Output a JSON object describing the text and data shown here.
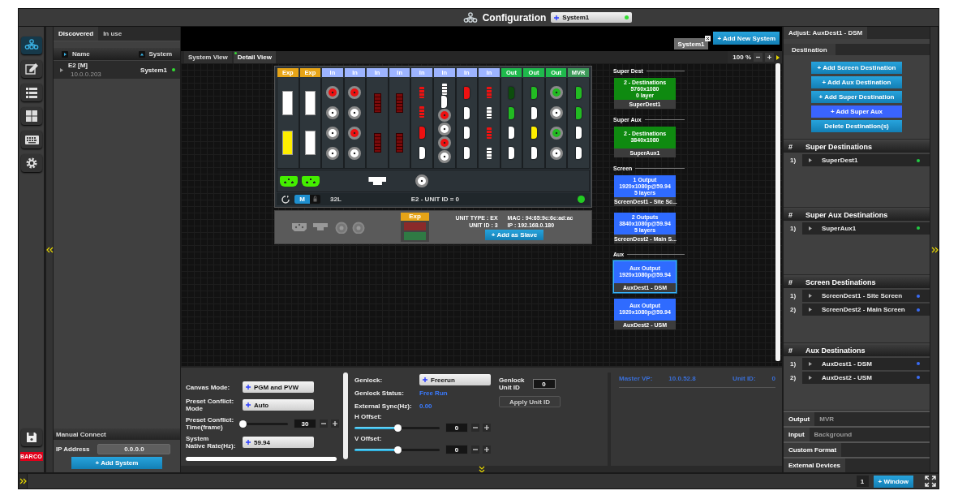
{
  "header": {
    "title": "Configuration",
    "system": "System1",
    "system_online": true
  },
  "rail": {
    "items": [
      {
        "kind": "network",
        "selected": true
      },
      {
        "kind": "edit",
        "selected": false
      },
      {
        "kind": "list",
        "selected": false
      },
      {
        "kind": "grid",
        "selected": false
      },
      {
        "kind": "keyboard",
        "selected": false
      },
      {
        "kind": "settings",
        "selected": false
      }
    ],
    "logo": "BARCO"
  },
  "discovery": {
    "tabs": [
      {
        "label": "Discovered",
        "selected": true
      },
      {
        "label": "In use",
        "selected": false
      }
    ],
    "columns": [
      "Name",
      "System"
    ],
    "rows": [
      {
        "name": "E2  [M]",
        "address": "10.0.0.203",
        "system": "System1",
        "online": true
      }
    ],
    "manual_connect": {
      "title": "Manual Connect",
      "ip_label": "IP Address",
      "ip_value": "0.0.0.0",
      "button": "+ Add System"
    }
  },
  "systems": {
    "tabs": [
      {
        "label": "System1",
        "selected": true
      }
    ],
    "add_button": "+ Add New System"
  },
  "view_tabs": [
    {
      "label": "System View",
      "selected": false
    },
    {
      "label": "Detail View",
      "selected": true
    }
  ],
  "zoom": "100 %",
  "chassis": {
    "slots": [
      {
        "label": "Exp",
        "kind": "exp",
        "ports": [
          {
            "kind": "rect",
            "color": "#ffffff"
          },
          {
            "kind": "rect",
            "color": "#ffee00"
          }
        ],
        "rear": {
          "kind": "power",
          "color": "#44ee00"
        }
      },
      {
        "label": "Exp",
        "kind": "exp",
        "ports": [
          {
            "kind": "rect",
            "color": "#ffffff"
          },
          {
            "kind": "rect",
            "color": "#ffffff"
          }
        ],
        "rear": {
          "kind": "power",
          "color": "#44ee00"
        }
      },
      {
        "label": "In",
        "kind": "in",
        "ports": [
          {
            "kind": "bnc",
            "color": "#ee1111"
          },
          {
            "kind": "bnc",
            "color": "#ffffff"
          },
          {
            "kind": "bnc",
            "color": "#ffffff"
          },
          {
            "kind": "bnc",
            "color": "#ffffff"
          }
        ]
      },
      {
        "label": "In",
        "kind": "in",
        "ports": [
          {
            "kind": "bnc",
            "color": "#ee1111"
          },
          {
            "kind": "bnc",
            "color": "#ffffff"
          },
          {
            "kind": "bnc",
            "color": "#ee1111"
          },
          {
            "kind": "bnc",
            "color": "#ffffff"
          }
        ]
      },
      {
        "label": "In",
        "kind": "in",
        "ports": [
          {
            "kind": "dvi",
            "color": "#7a0a0a"
          },
          {
            "kind": "dvi",
            "color": "#7a0a0a"
          }
        ],
        "rear": {
          "kind": "ethernet",
          "color": "#ffffff"
        }
      },
      {
        "label": "In",
        "kind": "in",
        "ports": [
          {
            "kind": "dvi",
            "color": "#7a0a0a"
          },
          {
            "kind": "dvi",
            "color": "#7a0a0a"
          }
        ]
      },
      {
        "label": "In",
        "kind": "in",
        "ports": [
          {
            "kind": "dp",
            "color": "#ee1111"
          },
          {
            "kind": "dp",
            "color": "#ee1111"
          },
          {
            "kind": "hdmi",
            "color": "#ee1111"
          },
          {
            "kind": "hdmi",
            "color": "#ffffff"
          }
        ],
        "rear": {
          "kind": "bnc",
          "color": "#ffffff"
        }
      },
      {
        "label": "In",
        "kind": "in",
        "ports": [
          {
            "kind": "dp",
            "color": "#ffffff"
          },
          {
            "kind": "hdmi",
            "color": "#ffffff"
          },
          {
            "kind": "bnc",
            "color": "#ee1111"
          },
          {
            "kind": "bnc",
            "color": "#ffffff"
          },
          {
            "kind": "bnc",
            "color": "#ee1111"
          },
          {
            "kind": "bnc",
            "color": "#ffffff"
          }
        ]
      },
      {
        "label": "In",
        "kind": "in",
        "ports": [
          {
            "kind": "hdmi",
            "color": "#ee1111"
          },
          {
            "kind": "hdmi",
            "color": "#ffffff"
          },
          {
            "kind": "hdmi",
            "color": "#ffffff"
          },
          {
            "kind": "hdmi",
            "color": "#ffffff"
          }
        ]
      },
      {
        "label": "In",
        "kind": "in",
        "ports": [
          {
            "kind": "dp",
            "color": "#ee1111"
          },
          {
            "kind": "dp",
            "color": "#ffffff"
          },
          {
            "kind": "dp",
            "color": "#ee1111"
          },
          {
            "kind": "dp",
            "color": "#ffffff"
          }
        ]
      },
      {
        "label": "Out",
        "kind": "out",
        "ports": [
          {
            "kind": "hdmi",
            "color": "#0d4d0d"
          },
          {
            "kind": "hdmi",
            "color": "#22bb22"
          },
          {
            "kind": "hdmi",
            "color": "#ffffff"
          },
          {
            "kind": "hdmi",
            "color": "#ffffff"
          }
        ]
      },
      {
        "label": "Out",
        "kind": "out",
        "ports": [
          {
            "kind": "hdmi",
            "color": "#22bb22"
          },
          {
            "kind": "hdmi",
            "color": "#ffffff"
          },
          {
            "kind": "hdmi",
            "color": "#ffee00"
          },
          {
            "kind": "hdmi",
            "color": "#ffffff"
          }
        ]
      },
      {
        "label": "Out",
        "kind": "out",
        "ports": [
          {
            "kind": "bnc",
            "color": "#22bb22"
          },
          {
            "kind": "bnc",
            "color": "#ffffff"
          },
          {
            "kind": "bnc",
            "color": "#22bb22"
          },
          {
            "kind": "bnc",
            "color": "#ffffff"
          }
        ]
      },
      {
        "label": "MVR",
        "kind": "mvr",
        "ports": [
          {
            "kind": "hdmi",
            "color": "#22bb22"
          },
          {
            "kind": "hdmi",
            "color": "#22bb22"
          },
          {
            "kind": "hdmi",
            "color": "#ffffff"
          },
          {
            "kind": "hdmi",
            "color": "#ffffff"
          }
        ]
      }
    ],
    "mode": "M",
    "mode_on": true,
    "format": "32L",
    "unit": "E2 - UNIT ID = 0",
    "online": true,
    "expansion": {
      "label": "Exp",
      "unit_type": "UNIT TYPE : EX",
      "mac": "MAC : 94:65:9c:6c:ad:ac",
      "unit_id": "UNIT ID : 3",
      "ip": "IP : 192.168.0.180",
      "button": "+ Add as Slave"
    }
  },
  "destinations": [
    {
      "title": "Super Dest",
      "cards": [
        {
          "kind": "super",
          "lines": [
            "2 - Destinations",
            "5760x1080",
            "0 layer"
          ],
          "name": "SuperDest1",
          "selected": false
        }
      ]
    },
    {
      "title": "Super Aux",
      "cards": [
        {
          "kind": "super",
          "lines": [
            "2 - Destinations",
            "3840x1080"
          ],
          "name": "SuperAux1",
          "selected": false
        }
      ]
    },
    {
      "title": "Screen",
      "cards": [
        {
          "kind": "screen",
          "lines": [
            "1 Output",
            "1920x1080p@59.94",
            "5 layers"
          ],
          "name": "ScreenDest1 - Site Sc...",
          "selected": false
        },
        {
          "kind": "screen",
          "lines": [
            "2 Outputs",
            "3840x1080p@59.94",
            "5 layers"
          ],
          "name": "ScreenDest2 - Main S...",
          "selected": false
        }
      ]
    },
    {
      "title": "Aux",
      "cards": [
        {
          "kind": "aux",
          "lines": [
            "Aux Output",
            "1920x1080p@59.94"
          ],
          "name": "AuxDest1 - DSM",
          "selected": true
        },
        {
          "kind": "aux",
          "lines": [
            "Aux Output",
            "1920x1080p@59.94"
          ],
          "name": "AuxDest2 - USM",
          "selected": false
        }
      ]
    }
  ],
  "settings": {
    "fields": [
      {
        "kind": "select",
        "label": "Canvas Mode:",
        "value": "PGM and PVW"
      },
      {
        "kind": "select",
        "label": "Preset Conflict:\nMode",
        "value": "Auto"
      },
      {
        "kind": "slider",
        "label": "Preset Conflict:\nTime(frame)",
        "level": 0,
        "value": "30"
      },
      {
        "kind": "select",
        "label": "System\nNative Rate(Hz):",
        "value": "59.94"
      }
    ]
  },
  "genlock": {
    "fields": [
      {
        "kind": "select",
        "label": "Genlock:",
        "value": "Freerun"
      },
      {
        "kind": "status",
        "label": "Genlock Status:",
        "value": "Free Run"
      },
      {
        "kind": "status",
        "label": "External Sync(Hz):",
        "value": "0.00"
      },
      {
        "kind": "slider",
        "label": "H Offset:",
        "level": 0.5,
        "value": "0"
      },
      {
        "kind": "slider",
        "label": "V Offset:",
        "level": 0.5,
        "value": "0"
      }
    ],
    "unit_id_label": "Genlock\nUnit ID",
    "unit_id": "0",
    "apply_button": "Apply Unit ID"
  },
  "master": {
    "label": "Master VP:",
    "value": "10.0.52.8",
    "unit_label": "Unit ID:",
    "unit_value": "0"
  },
  "adjust": {
    "tabs": [
      {
        "label": "Adjust: AuxDest1 - DSM",
        "selected": true
      }
    ],
    "sub_tabs": [
      {
        "label": "Destination",
        "selected": true
      }
    ],
    "actions": [
      {
        "label": "+ Add Screen Destination",
        "highlighted": false
      },
      {
        "label": "+ Add Aux Destination",
        "highlighted": false
      },
      {
        "label": "+ Add Super Destination",
        "highlighted": false
      },
      {
        "label": "+ Add Super Aux",
        "highlighted": true
      },
      {
        "label": "Delete Destination(s)",
        "highlighted": false
      }
    ],
    "sections": [
      {
        "number_heading": "#",
        "title": "Super Destinations",
        "items": [
          {
            "number": "1)",
            "name": "SuperDest1",
            "color": "#22cc44"
          }
        ]
      },
      {
        "number_heading": "#",
        "title": "Super Aux Destinations",
        "items": [
          {
            "number": "1)",
            "name": "SuperAux1",
            "color": "#22cc44"
          }
        ]
      },
      {
        "number_heading": "#",
        "title": "Screen Destinations",
        "items": [
          {
            "number": "1)",
            "name": "ScreenDest1 - Site Screen",
            "color": "#3a6cf5"
          },
          {
            "number": "2)",
            "name": "ScreenDest2 - Main Screen",
            "color": "#3a6cf5"
          }
        ]
      },
      {
        "number_heading": "#",
        "title": "Aux Destinations",
        "items": [
          {
            "number": "1)",
            "name": "AuxDest1 - DSM",
            "color": "#3a6cf5"
          },
          {
            "number": "2)",
            "name": "AuxDest2 - USM",
            "color": "#3a6cf5"
          }
        ]
      }
    ],
    "bottom_tabs": [
      [
        {
          "label": "Output",
          "selected": true
        },
        {
          "label": "MVR",
          "selected": false
        }
      ],
      [
        {
          "label": "Input",
          "selected": true
        },
        {
          "label": "Background",
          "selected": false
        }
      ],
      [
        {
          "label": "Custom Format",
          "selected": true
        }
      ],
      [
        {
          "label": "External Devices",
          "selected": true
        }
      ]
    ]
  },
  "status_bar": {
    "page": "1",
    "window_button": "+ Window"
  }
}
